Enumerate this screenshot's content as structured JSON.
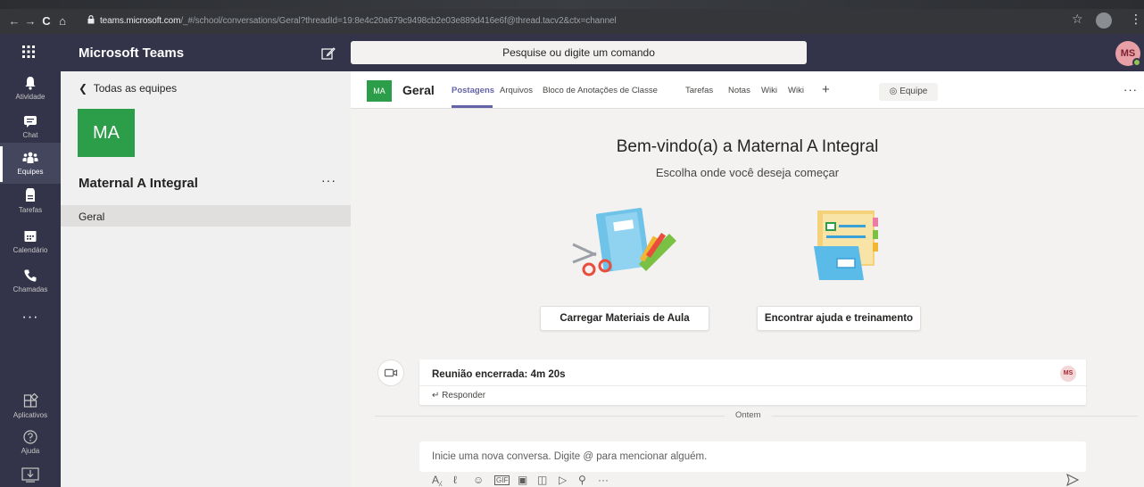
{
  "browser": {
    "url_host": "teams.microsoft.com",
    "url_path": "/_#/school/conversations/Geral?threadId=19:8e4c20a679c9498cb2e03e889d416e6f@thread.tacv2&ctx=channel"
  },
  "header": {
    "app_title": "Microsoft Teams",
    "search_placeholder": "Pesquise ou digite um comando",
    "avatar_initials": "MS"
  },
  "rail": {
    "items": [
      {
        "label": "Atividade",
        "icon": "bell-icon"
      },
      {
        "label": "Chat",
        "icon": "chat-icon"
      },
      {
        "label": "Equipes",
        "icon": "teams-icon"
      },
      {
        "label": "Tarefas",
        "icon": "assignments-icon"
      },
      {
        "label": "Calendário",
        "icon": "calendar-icon"
      },
      {
        "label": "Chamadas",
        "icon": "phone-icon"
      },
      {
        "label": "Aplicativos",
        "icon": "apps-icon"
      },
      {
        "label": "Ajuda",
        "icon": "help-icon"
      }
    ],
    "more": "···"
  },
  "panel": {
    "back_label": "Todas as equipes",
    "team_initials": "MA",
    "team_name": "Maternal A Integral",
    "more": "···",
    "channels": [
      "Geral"
    ]
  },
  "channel": {
    "tile": "MA",
    "name": "Geral",
    "tabs": [
      "Postagens",
      "Arquivos",
      "Bloco de Anotações de Classe",
      "Tarefas",
      "Notas",
      "Wiki",
      "Wiki"
    ],
    "active_tab": "Postagens",
    "team_button": "Equipe",
    "more": "···"
  },
  "welcome": {
    "title": "Bem-vindo(a) a Maternal A Integral",
    "subtitle": "Escolha onde você deseja começar",
    "button1": "Carregar Materiais de Aula",
    "button2": "Encontrar ajuda e treinamento"
  },
  "meeting": {
    "title": "Reunião encerrada: 4m 20s",
    "reply": "Responder",
    "avatar": "MS"
  },
  "date_separator": "Ontem",
  "composer": {
    "placeholder": "Inicie uma nova conversa. Digite @ para mencionar alguém."
  },
  "colors": {
    "rail": "#33344a",
    "accent": "#6264a7",
    "team_tile": "#2c9d48"
  }
}
